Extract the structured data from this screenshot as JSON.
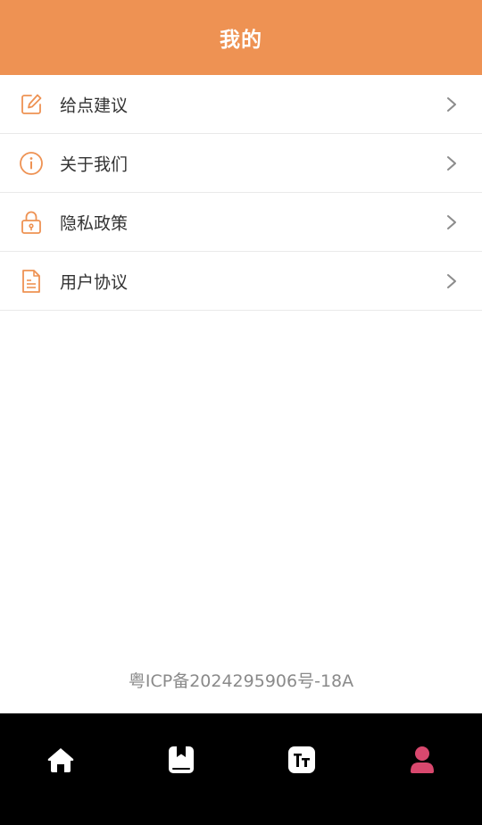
{
  "header": {
    "title": "我的"
  },
  "menu": {
    "items": [
      {
        "label": "给点建议",
        "icon": "edit-icon"
      },
      {
        "label": "关于我们",
        "icon": "info-icon"
      },
      {
        "label": "隐私政策",
        "icon": "lock-icon"
      },
      {
        "label": "用户协议",
        "icon": "document-icon"
      }
    ]
  },
  "footer": {
    "icp": "粤ICP备2024295906号-18A"
  },
  "tabbar": {
    "items": [
      {
        "icon": "home-icon",
        "active": false
      },
      {
        "icon": "bookmark-book-icon",
        "active": false
      },
      {
        "icon": "text-size-icon",
        "active": false
      },
      {
        "icon": "user-icon",
        "active": true
      }
    ]
  },
  "colors": {
    "accent": "#EE9253",
    "active_tab": "#D9486E",
    "tab_bg": "#000000"
  }
}
